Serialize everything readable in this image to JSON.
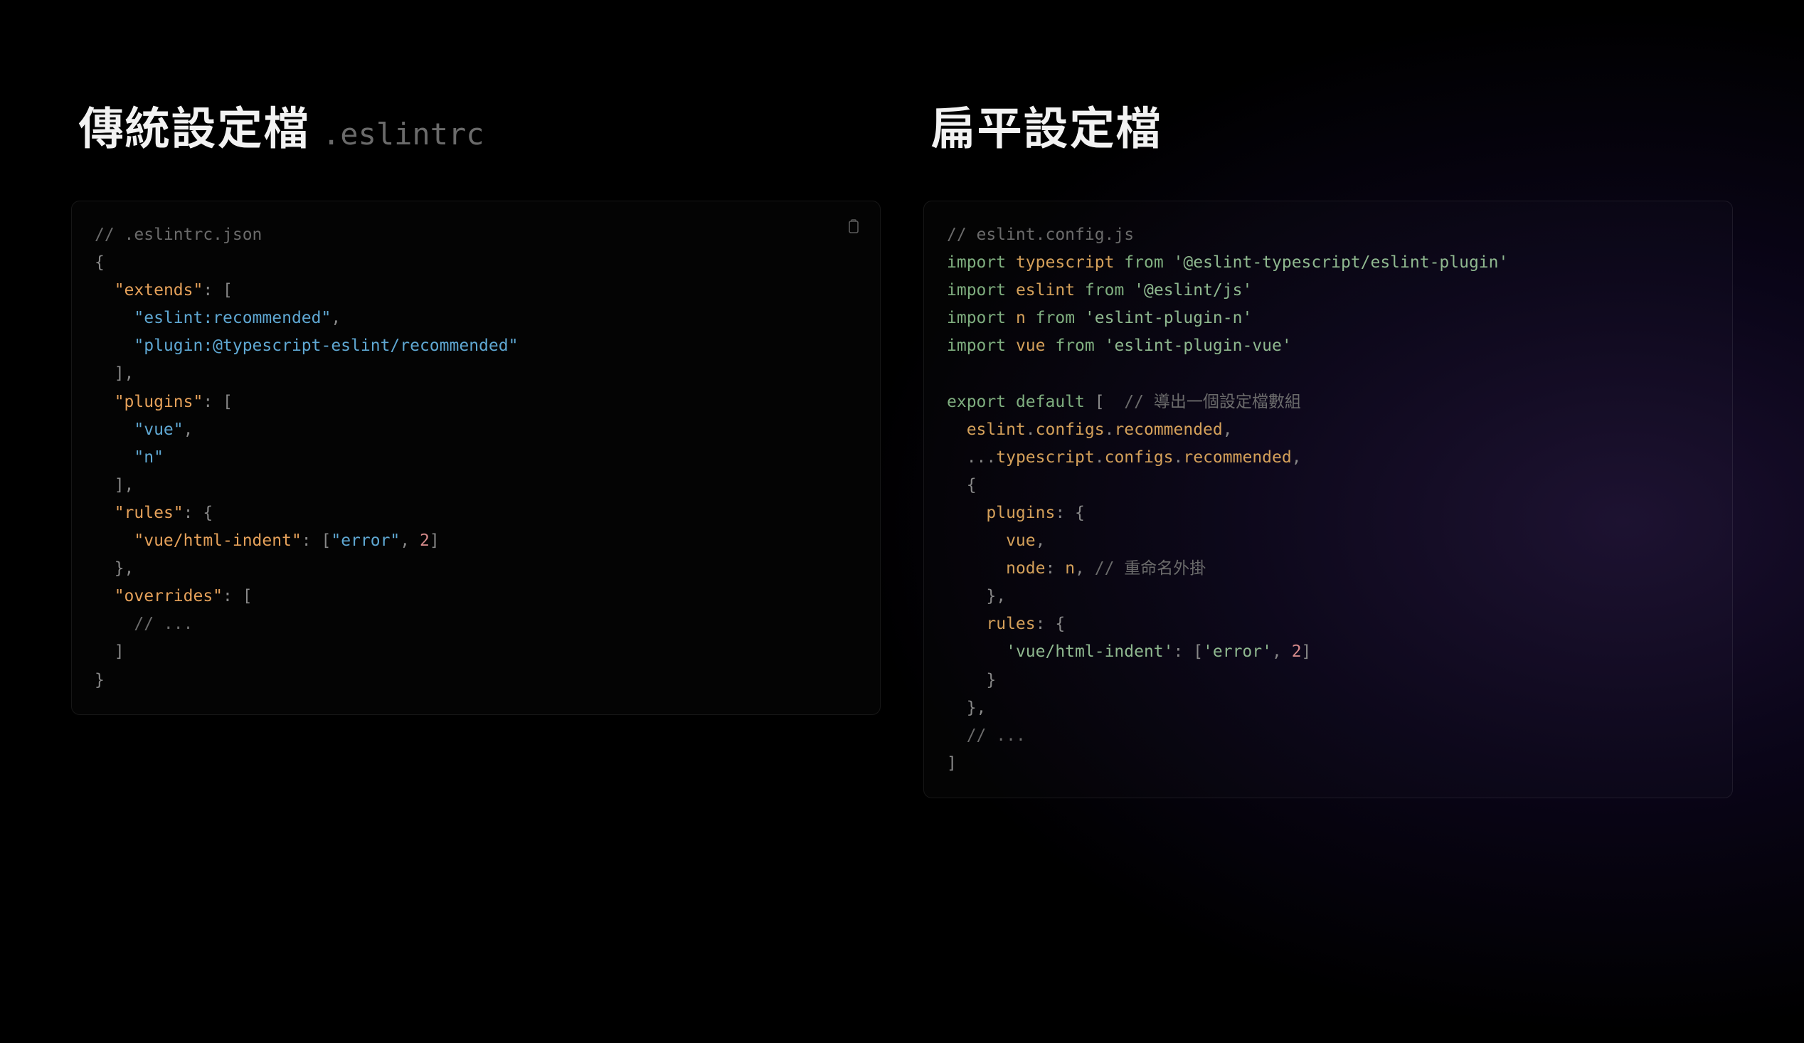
{
  "left": {
    "title": "傳統設定檔",
    "subtitle": ".eslintrc",
    "code": {
      "tokens": [
        [
          {
            "t": "// .eslintrc.json",
            "c": "c-comment"
          }
        ],
        [
          {
            "t": "{",
            "c": "c-punct"
          }
        ],
        [
          {
            "t": "  ",
            "c": ""
          },
          {
            "t": "\"extends\"",
            "c": "c-key"
          },
          {
            "t": ": [",
            "c": "c-punct"
          }
        ],
        [
          {
            "t": "    ",
            "c": ""
          },
          {
            "t": "\"eslint:recommended\"",
            "c": "c-string"
          },
          {
            "t": ",",
            "c": "c-punct"
          }
        ],
        [
          {
            "t": "    ",
            "c": ""
          },
          {
            "t": "\"plugin:@typescript-eslint/recommended\"",
            "c": "c-string"
          }
        ],
        [
          {
            "t": "  ",
            "c": ""
          },
          {
            "t": "],",
            "c": "c-punct"
          }
        ],
        [
          {
            "t": "  ",
            "c": ""
          },
          {
            "t": "\"plugins\"",
            "c": "c-key"
          },
          {
            "t": ": [",
            "c": "c-punct"
          }
        ],
        [
          {
            "t": "    ",
            "c": ""
          },
          {
            "t": "\"vue\"",
            "c": "c-string"
          },
          {
            "t": ",",
            "c": "c-punct"
          }
        ],
        [
          {
            "t": "    ",
            "c": ""
          },
          {
            "t": "\"n\"",
            "c": "c-string"
          }
        ],
        [
          {
            "t": "  ",
            "c": ""
          },
          {
            "t": "],",
            "c": "c-punct"
          }
        ],
        [
          {
            "t": "  ",
            "c": ""
          },
          {
            "t": "\"rules\"",
            "c": "c-key"
          },
          {
            "t": ": {",
            "c": "c-punct"
          }
        ],
        [
          {
            "t": "    ",
            "c": ""
          },
          {
            "t": "\"vue/html-indent\"",
            "c": "c-key"
          },
          {
            "t": ": [",
            "c": "c-punct"
          },
          {
            "t": "\"error\"",
            "c": "c-string"
          },
          {
            "t": ", ",
            "c": "c-punct"
          },
          {
            "t": "2",
            "c": "c-num"
          },
          {
            "t": "]",
            "c": "c-punct"
          }
        ],
        [
          {
            "t": "  ",
            "c": ""
          },
          {
            "t": "},",
            "c": "c-punct"
          }
        ],
        [
          {
            "t": "  ",
            "c": ""
          },
          {
            "t": "\"overrides\"",
            "c": "c-key"
          },
          {
            "t": ": [",
            "c": "c-punct"
          }
        ],
        [
          {
            "t": "    ",
            "c": ""
          },
          {
            "t": "// ...",
            "c": "c-comment"
          }
        ],
        [
          {
            "t": "  ",
            "c": ""
          },
          {
            "t": "]",
            "c": "c-punct"
          }
        ],
        [
          {
            "t": "}",
            "c": "c-punct"
          }
        ]
      ]
    }
  },
  "right": {
    "title": "扁平設定檔",
    "code": {
      "tokens": [
        [
          {
            "t": "// eslint.config.js",
            "c": "c-comment"
          }
        ],
        [
          {
            "t": "import",
            "c": "c-kw"
          },
          {
            "t": " ",
            "c": ""
          },
          {
            "t": "typescript",
            "c": "c-ident"
          },
          {
            "t": " ",
            "c": ""
          },
          {
            "t": "from",
            "c": "c-from"
          },
          {
            "t": " ",
            "c": ""
          },
          {
            "t": "'@eslint-typescript/eslint-plugin'",
            "c": "c-string2"
          }
        ],
        [
          {
            "t": "import",
            "c": "c-kw"
          },
          {
            "t": " ",
            "c": ""
          },
          {
            "t": "eslint",
            "c": "c-ident"
          },
          {
            "t": " ",
            "c": ""
          },
          {
            "t": "from",
            "c": "c-from"
          },
          {
            "t": " ",
            "c": ""
          },
          {
            "t": "'@eslint/js'",
            "c": "c-string2"
          }
        ],
        [
          {
            "t": "import",
            "c": "c-kw"
          },
          {
            "t": " ",
            "c": ""
          },
          {
            "t": "n",
            "c": "c-ident"
          },
          {
            "t": " ",
            "c": ""
          },
          {
            "t": "from",
            "c": "c-from"
          },
          {
            "t": " ",
            "c": ""
          },
          {
            "t": "'eslint-plugin-n'",
            "c": "c-string2"
          }
        ],
        [
          {
            "t": "import",
            "c": "c-kw"
          },
          {
            "t": " ",
            "c": ""
          },
          {
            "t": "vue",
            "c": "c-ident"
          },
          {
            "t": " ",
            "c": ""
          },
          {
            "t": "from",
            "c": "c-from"
          },
          {
            "t": " ",
            "c": ""
          },
          {
            "t": "'eslint-plugin-vue'",
            "c": "c-string2"
          }
        ],
        [
          {
            "t": " ",
            "c": ""
          }
        ],
        [
          {
            "t": "export",
            "c": "c-kw"
          },
          {
            "t": " ",
            "c": ""
          },
          {
            "t": "default",
            "c": "c-default"
          },
          {
            "t": " [  ",
            "c": "c-punct"
          },
          {
            "t": "// 導出一個設定檔數組",
            "c": "c-comment"
          }
        ],
        [
          {
            "t": "  eslint",
            "c": "c-ident"
          },
          {
            "t": ".",
            "c": "c-punct"
          },
          {
            "t": "configs",
            "c": "c-prop"
          },
          {
            "t": ".",
            "c": "c-punct"
          },
          {
            "t": "recommended",
            "c": "c-prop"
          },
          {
            "t": ",",
            "c": "c-punct"
          }
        ],
        [
          {
            "t": "  ...",
            "c": "c-punct"
          },
          {
            "t": "typescript",
            "c": "c-ident"
          },
          {
            "t": ".",
            "c": "c-punct"
          },
          {
            "t": "configs",
            "c": "c-prop"
          },
          {
            "t": ".",
            "c": "c-punct"
          },
          {
            "t": "recommended",
            "c": "c-prop"
          },
          {
            "t": ",",
            "c": "c-punct"
          }
        ],
        [
          {
            "t": "  {",
            "c": "c-punct"
          }
        ],
        [
          {
            "t": "    ",
            "c": ""
          },
          {
            "t": "plugins",
            "c": "c-prop"
          },
          {
            "t": ": {",
            "c": "c-punct"
          }
        ],
        [
          {
            "t": "      vue",
            "c": "c-ident"
          },
          {
            "t": ",",
            "c": "c-punct"
          }
        ],
        [
          {
            "t": "      ",
            "c": ""
          },
          {
            "t": "node",
            "c": "c-prop"
          },
          {
            "t": ": ",
            "c": "c-punct"
          },
          {
            "t": "n",
            "c": "c-ident"
          },
          {
            "t": ", ",
            "c": "c-punct"
          },
          {
            "t": "// 重命名外掛",
            "c": "c-comment"
          }
        ],
        [
          {
            "t": "    },",
            "c": "c-punct"
          }
        ],
        [
          {
            "t": "    ",
            "c": ""
          },
          {
            "t": "rules",
            "c": "c-prop"
          },
          {
            "t": ": {",
            "c": "c-punct"
          }
        ],
        [
          {
            "t": "      ",
            "c": ""
          },
          {
            "t": "'vue/html-indent'",
            "c": "c-string2"
          },
          {
            "t": ": [",
            "c": "c-punct"
          },
          {
            "t": "'error'",
            "c": "c-string2"
          },
          {
            "t": ", ",
            "c": "c-punct"
          },
          {
            "t": "2",
            "c": "c-num"
          },
          {
            "t": "]",
            "c": "c-punct"
          }
        ],
        [
          {
            "t": "    }",
            "c": "c-punct"
          }
        ],
        [
          {
            "t": "  },",
            "c": "c-punct"
          }
        ],
        [
          {
            "t": "  ",
            "c": ""
          },
          {
            "t": "// ...",
            "c": "c-comment"
          }
        ],
        [
          {
            "t": "]",
            "c": "c-punct"
          }
        ]
      ]
    }
  }
}
